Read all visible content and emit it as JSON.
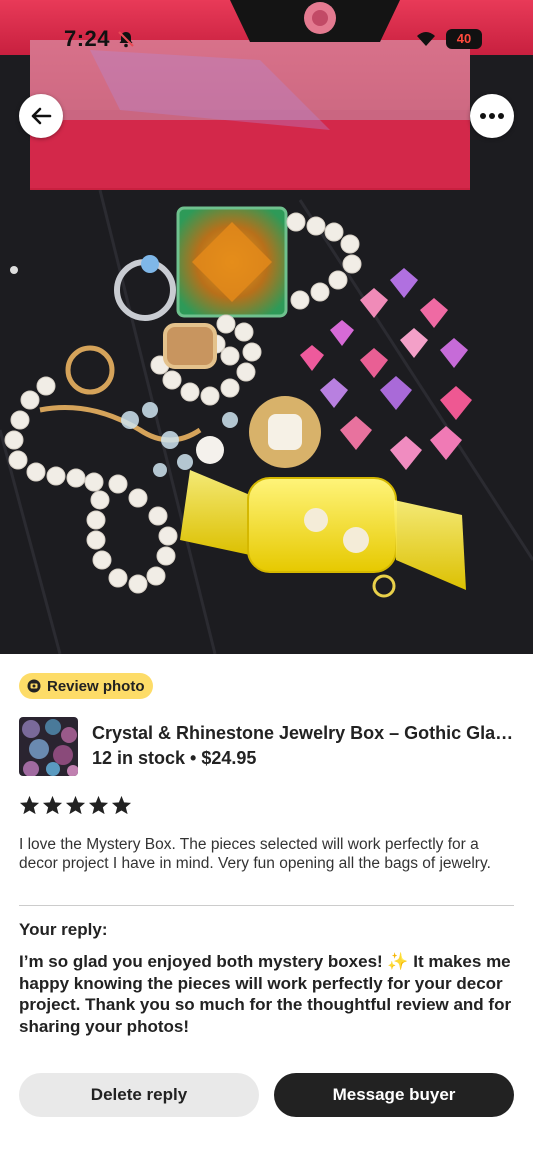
{
  "status_bar": {
    "time": "7:24",
    "battery": "40"
  },
  "header": {
    "back_icon": "arrow-left-icon",
    "more_icon": "ellipsis-icon"
  },
  "badge": {
    "label": "Review photo",
    "icon": "photo-icon",
    "color": "#fddc68"
  },
  "listing": {
    "title": "Crystal & Rhinestone Jewelry Box – Gothic Gla…",
    "meta": "12 in stock • $24.95"
  },
  "review": {
    "rating": 5,
    "text": "I love the Mystery Box. The pieces selected will work perfectly for a decor project I have in mind. Very fun opening all the bags of jewelry."
  },
  "reply": {
    "label": "Your reply:",
    "text": "I’m so glad you enjoyed both mystery boxes! ✨  It makes me happy knowing the pieces will work perfectly for your decor project. Thank you so much for the thoughtful review and for sharing your photos!"
  },
  "actions": {
    "delete_label": "Delete reply",
    "message_label": "Message buyer"
  },
  "colors": {
    "dark_button": "#222222",
    "light_button": "#e9e9e9",
    "star": "#222222"
  }
}
